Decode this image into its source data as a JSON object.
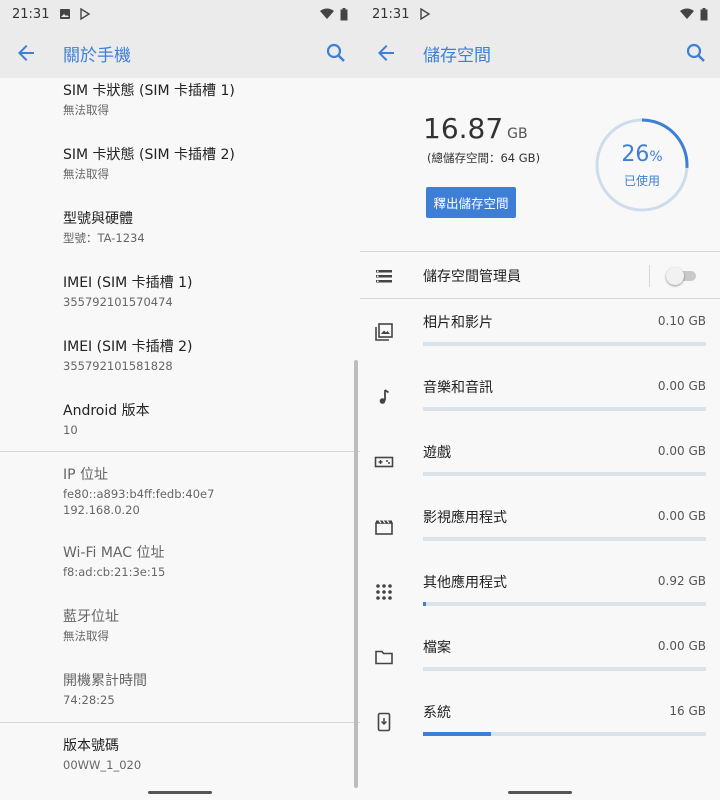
{
  "colors": {
    "accent": "#3d7fd6",
    "bar_track": "#dbe3ea",
    "toolbar_bg": "#ebebeb"
  },
  "left": {
    "status": {
      "time": "21:31"
    },
    "toolbar": {
      "title": "關於手機",
      "back_icon": "arrow-left-icon",
      "search_icon": "search-icon"
    },
    "items": [
      {
        "title": "SIM 卡狀態 (SIM 卡插槽 1)",
        "subtitle": "無法取得"
      },
      {
        "title": "SIM 卡狀態 (SIM 卡插槽 2)",
        "subtitle": "無法取得"
      },
      {
        "title": "型號與硬體",
        "subtitle": "型號：TA-1234"
      },
      {
        "title": "IMEI (SIM 卡插槽 1)",
        "subtitle": "355792101570474"
      },
      {
        "title": "IMEI (SIM 卡插槽 2)",
        "subtitle": "355792101581828"
      },
      {
        "title": "Android 版本",
        "subtitle": "10"
      },
      {
        "title": "IP 位址",
        "subtitle": "fe80::a893:b4ff:fedb:40e7",
        "subtitle2": "192.168.0.20"
      },
      {
        "title": "Wi-Fi MAC 位址",
        "subtitle": "f8:ad:cb:21:3e:15"
      },
      {
        "title": "藍牙位址",
        "subtitle": "無法取得"
      },
      {
        "title": "開機累計時間",
        "subtitle": "74:28:25"
      },
      {
        "title": "版本號碼",
        "subtitle": "00WW_1_020"
      }
    ]
  },
  "right": {
    "status": {
      "time": "21:31"
    },
    "toolbar": {
      "title": "儲存空間",
      "back_icon": "arrow-left-icon",
      "search_icon": "search-icon"
    },
    "summary": {
      "used_value": "16.87",
      "used_unit": "GB",
      "capacity": "(總儲存空間：64 GB)",
      "free_button": "釋出儲存空間",
      "percent": "26",
      "percent_sign": "%",
      "used_label": "已使用",
      "used_fraction": 0.26
    },
    "manager": {
      "label": "儲存空間管理員",
      "icon": "storage-manager-icon",
      "enabled": false
    },
    "categories": [
      {
        "label": "相片和影片",
        "size": "0.10 GB",
        "icon": "photos-icon",
        "fraction": 0.0
      },
      {
        "label": "音樂和音訊",
        "size": "0.00 GB",
        "icon": "music-note-icon",
        "fraction": 0.0
      },
      {
        "label": "遊戲",
        "size": "0.00 GB",
        "icon": "gamepad-icon",
        "fraction": 0.0
      },
      {
        "label": "影視應用程式",
        "size": "0.00 GB",
        "icon": "movie-icon",
        "fraction": 0.0
      },
      {
        "label": "其他應用程式",
        "size": "0.92 GB",
        "icon": "apps-grid-icon",
        "fraction": 0.01
      },
      {
        "label": "檔案",
        "size": "0.00 GB",
        "icon": "folder-icon",
        "fraction": 0.0
      },
      {
        "label": "系統",
        "size": "16 GB",
        "icon": "system-update-icon",
        "fraction": 0.24
      }
    ]
  }
}
